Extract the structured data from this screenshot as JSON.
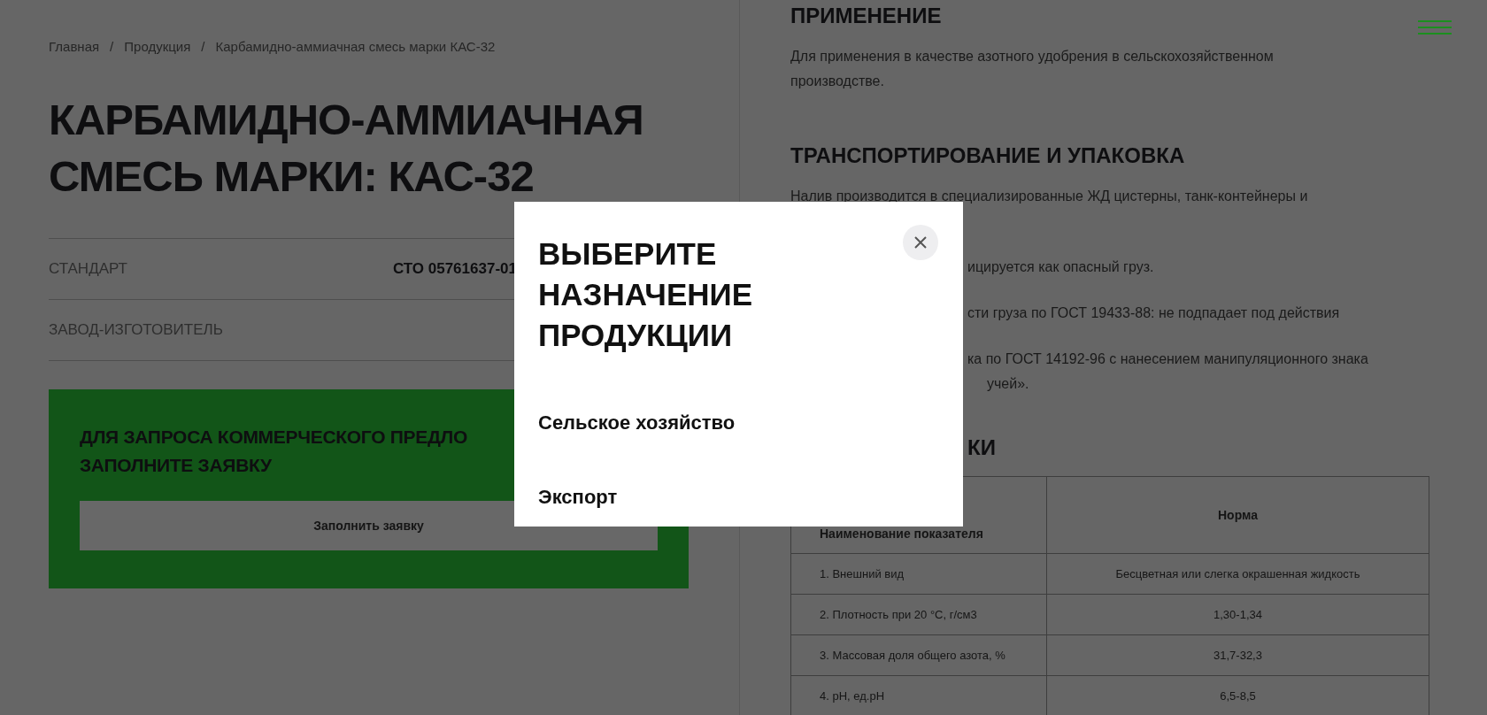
{
  "breadcrumbs": [
    {
      "label": "Главная"
    },
    {
      "label": "Продукция"
    },
    {
      "label": "Карбамидно-аммиачная смесь марки КАС-32"
    }
  ],
  "breadcrumb_separator": "/",
  "title": "КАРБАМИДНО-АММИАЧНАЯ СМЕСЬ МАРКИ: КАС-32",
  "specs": [
    {
      "label": "СТАНДАРТ",
      "value": "СТО 05761637-01"
    },
    {
      "label": "ЗАВОД-ИЗГОТОВИТЕЛЬ"
    }
  ],
  "request_card": {
    "heading_lines": [
      "ДЛЯ ЗАПРОСА КОММЕРЧЕСКОГО ПРЕДЛО",
      "ЗАПОЛНИТЕ ЗАЯВКУ"
    ],
    "button": "Заполнить заявку"
  },
  "sections": [
    {
      "kind": "heading",
      "text": "ПРИМЕНЕНИЕ"
    },
    {
      "kind": "paragraph",
      "text": "Для применения в качестве азотного удобрения в сельскохозяйственном производстве."
    },
    {
      "kind": "heading",
      "text": "ТРАНСПОРТИРОВАНИЕ И УПАКОВКА"
    },
    {
      "kind": "paragraph",
      "text": "Налив производится в специализированные ЖД цистерны, танк-контейнеры и"
    },
    {
      "kind": "clipped_paragraph",
      "text": "ицируется как опасный груз."
    },
    {
      "kind": "clipped_paragraph",
      "text": "сти груза по ГОСТ 19433-88: не подпадает под действия"
    },
    {
      "kind": "clipped_line",
      "text": "ка по ГОСТ 14192-96 с нанесением манипуляционного знака"
    },
    {
      "kind": "clipped_tail",
      "text": "учей»."
    },
    {
      "kind": "clipped_heading",
      "text": "КИ"
    }
  ],
  "table": {
    "columns": [
      "Наименование показателя",
      "Норма"
    ],
    "rows": [
      [
        "1. Внешний вид",
        "Бесцветная или слегка окрашенная жидкость"
      ],
      [
        "2. Плотность при 20 °С, г/см3",
        "1,30-1,34"
      ],
      [
        "3. Массовая доля общего азота, %",
        "31,7-32,3"
      ],
      [
        "4. рН, ед.рН",
        "6,5-8,5"
      ]
    ]
  },
  "modal": {
    "title": "ВЫБЕРИТЕ НАЗНАЧЕНИЕ ПРОДУКЦИИ",
    "options": [
      "Сельское хозяйство",
      "Экспорт"
    ]
  }
}
